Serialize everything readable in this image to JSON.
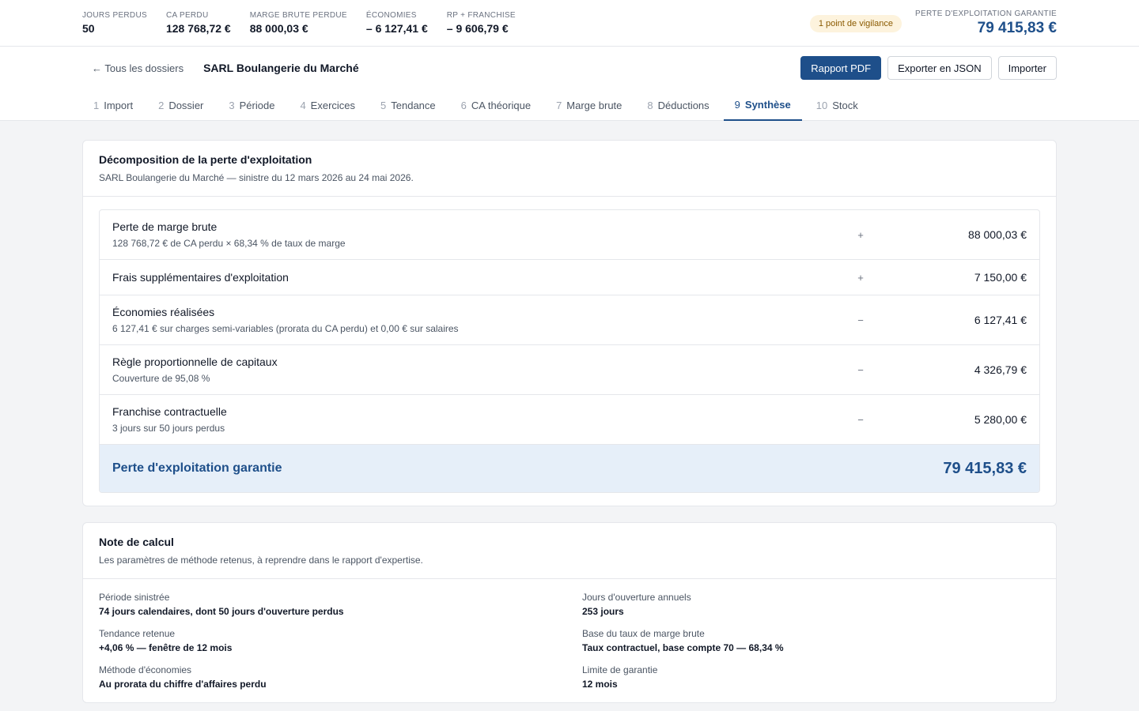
{
  "kpis": {
    "jours_perdus": {
      "label": "JOURS PERDUS",
      "value": "50"
    },
    "ca_perdu": {
      "label": "CA PERDU",
      "value": "128 768,72 €"
    },
    "marge": {
      "label": "MARGE BRUTE PERDUE",
      "value": "88 000,03 €"
    },
    "economies": {
      "label": "ÉCONOMIES",
      "value": "– 6 127,41 €"
    },
    "rp": {
      "label": "RP + FRANCHISE",
      "value": "– 9 606,79 €"
    },
    "vigilance": "1 point de vigilance",
    "garantie": {
      "label": "PERTE D'EXPLOITATION GARANTIE",
      "value": "79 415,83 €"
    }
  },
  "header": {
    "back_label": "← Tous les dossiers",
    "title": "SARL Boulangerie du Marché",
    "pdf_label": "Rapport PDF",
    "json_label": "Exporter en JSON",
    "import_label": "Importer"
  },
  "tabs": [
    {
      "num": "1",
      "label": "Import"
    },
    {
      "num": "2",
      "label": "Dossier"
    },
    {
      "num": "3",
      "label": "Période"
    },
    {
      "num": "4",
      "label": "Exercices"
    },
    {
      "num": "5",
      "label": "Tendance"
    },
    {
      "num": "6",
      "label": "CA théorique"
    },
    {
      "num": "7",
      "label": "Marge brute"
    },
    {
      "num": "8",
      "label": "Déductions"
    },
    {
      "num": "9",
      "label": "Synthèse"
    },
    {
      "num": "10",
      "label": "Stock"
    }
  ],
  "decomposition": {
    "title": "Décomposition de la perte d'exploitation",
    "subtitle": "SARL Boulangerie du Marché — sinistre du 12 mars 2026 au 24 mai 2026.",
    "rows": [
      {
        "label": "Perte de marge brute",
        "detail": "128 768,72 € de CA perdu × 68,34 % de taux de marge",
        "sign": "+",
        "amount": "88 000,03 €"
      },
      {
        "label": "Frais supplémentaires d'exploitation",
        "detail": "",
        "sign": "+",
        "amount": "7 150,00 €"
      },
      {
        "label": "Économies réalisées",
        "detail": "6 127,41 € sur charges semi-variables (prorata du CA perdu) et 0,00 € sur salaires",
        "sign": "−",
        "amount": "6 127,41 €"
      },
      {
        "label": "Règle proportionnelle de capitaux",
        "detail": "Couverture de 95,08 %",
        "sign": "−",
        "amount": "4 326,79 €"
      },
      {
        "label": "Franchise contractuelle",
        "detail": "3 jours sur 50 jours perdus",
        "sign": "−",
        "amount": "5 280,00 €"
      }
    ],
    "total_label": "Perte d'exploitation garantie",
    "total_amount": "79 415,83 €"
  },
  "note": {
    "title": "Note de calcul",
    "subtitle": "Les paramètres de méthode retenus, à reprendre dans le rapport d'expertise.",
    "items": [
      {
        "label": "Période sinistrée",
        "value": "74 jours calendaires, dont 50 jours d'ouverture perdus"
      },
      {
        "label": "Jours d'ouverture annuels",
        "value": "253 jours"
      },
      {
        "label": "Tendance retenue",
        "value": "+4,06 % — fenêtre de 12 mois"
      },
      {
        "label": "Base du taux de marge brute",
        "value": "Taux contractuel, base compte 70 — 68,34 %"
      },
      {
        "label": "Méthode d'économies",
        "value": "Au prorata du chiffre d'affaires perdu"
      },
      {
        "label": "Limite de garantie",
        "value": "12 mois"
      }
    ]
  }
}
